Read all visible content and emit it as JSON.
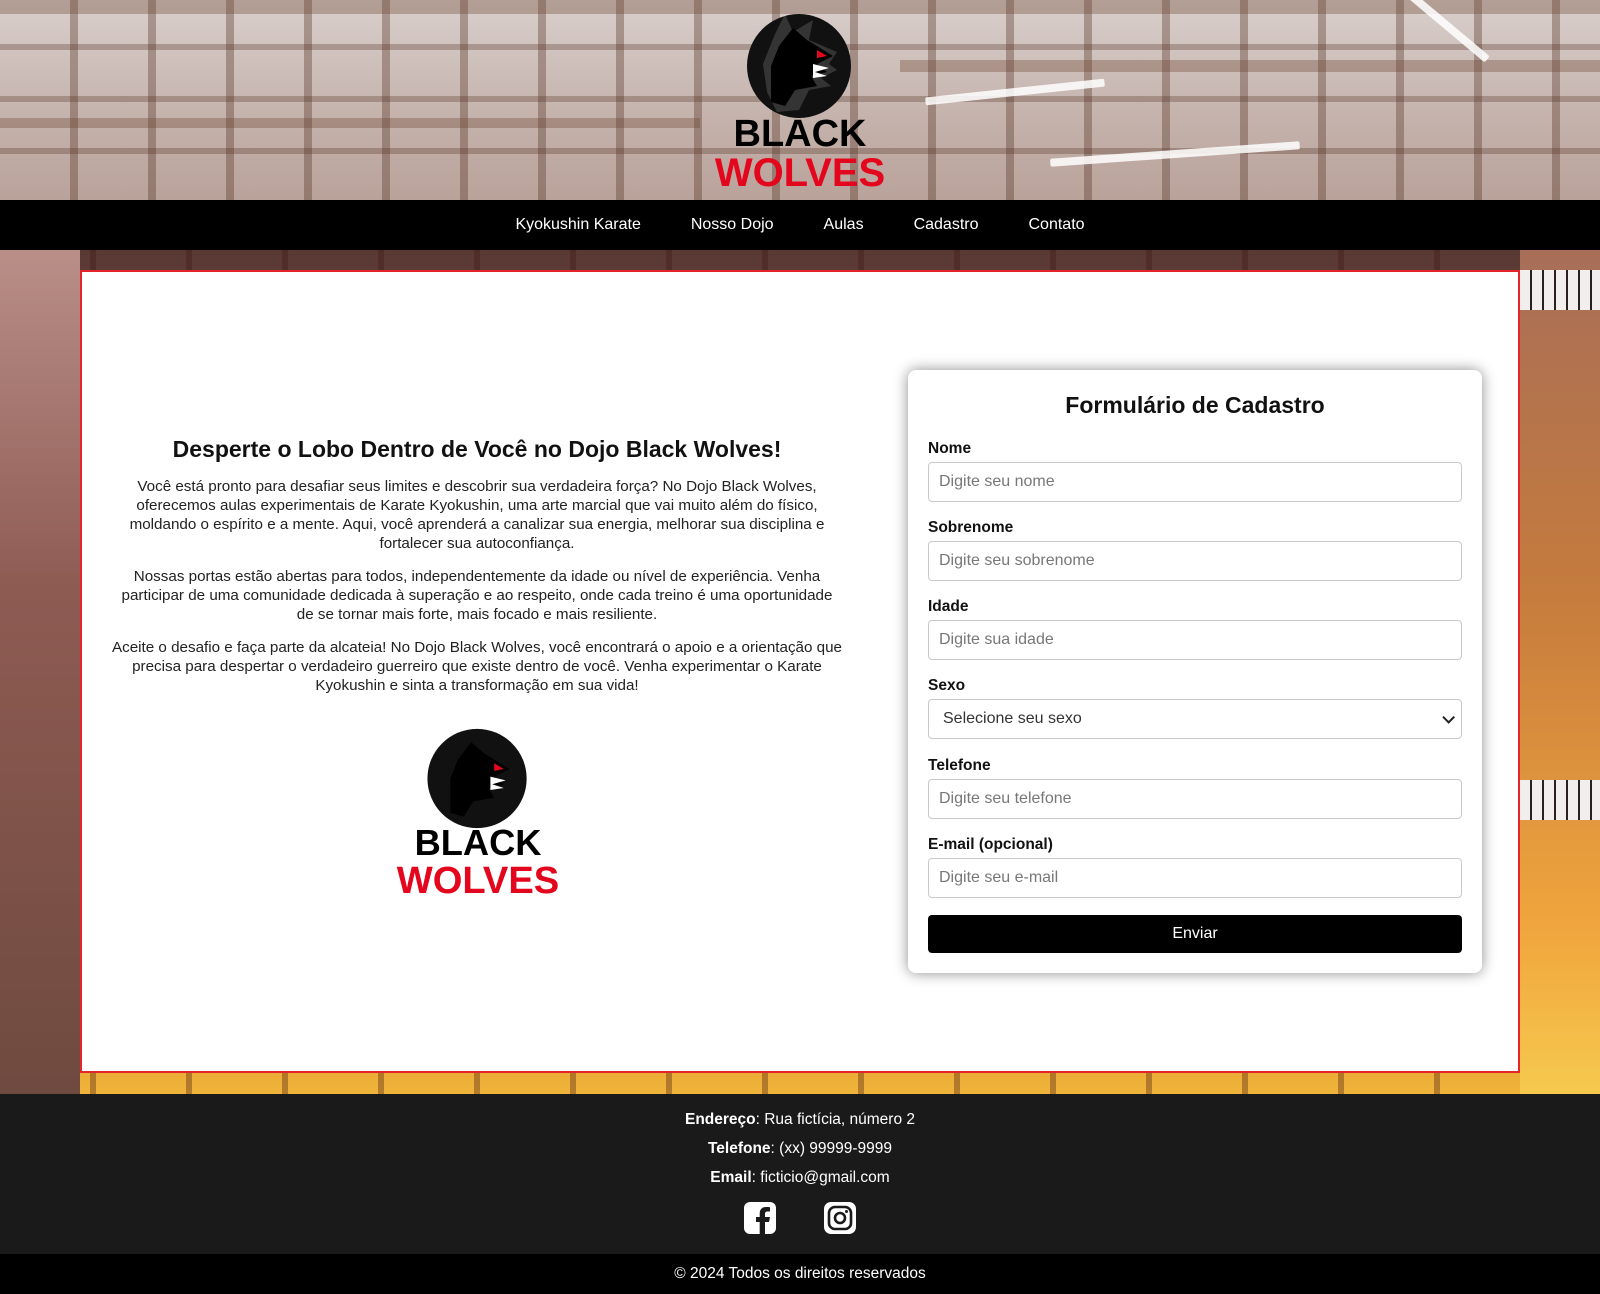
{
  "brand": {
    "logo_line1": "BLACK",
    "logo_line2": "WOLVES",
    "colors": {
      "red": "#e3061c",
      "black": "#000000",
      "accent_border": "#e3242b"
    }
  },
  "nav": {
    "items": [
      {
        "label": "Kyokushin Karate"
      },
      {
        "label": "Nosso Dojo"
      },
      {
        "label": "Aulas"
      },
      {
        "label": "Cadastro"
      },
      {
        "label": "Contato"
      }
    ]
  },
  "intro": {
    "title": "Desperte o Lobo Dentro de Você no Dojo Black Wolves!",
    "paragraphs": [
      "Você está pronto para desafiar seus limites e descobrir sua verdadeira força? No Dojo Black Wolves, oferecemos aulas experimentais de Karate Kyokushin, uma arte marcial que vai muito além do físico, moldando o espírito e a mente. Aqui, você aprenderá a canalizar sua energia, melhorar sua disciplina e fortalecer sua autoconfiança.",
      "Nossas portas estão abertas para todos, independentemente da idade ou nível de experiência. Venha participar de uma comunidade dedicada à superação e ao respeito, onde cada treino é uma oportunidade de se tornar mais forte, mais focado e mais resiliente.",
      "Aceite o desafio e faça parte da alcateia! No Dojo Black Wolves, você encontrará o apoio e a orientação que precisa para despertar o verdadeiro guerreiro que existe dentro de você. Venha experimentar o Karate Kyokushin e sinta a transformação em sua vida!"
    ]
  },
  "form": {
    "title": "Formulário de Cadastro",
    "fields": [
      {
        "label": "Nome",
        "placeholder": "Digite seu nome",
        "value": ""
      },
      {
        "label": "Sobrenome",
        "placeholder": "Digite seu sobrenome",
        "value": ""
      },
      {
        "label": "Idade",
        "placeholder": "Digite sua idade",
        "value": ""
      },
      {
        "label": "Sexo",
        "selected": "Selecione seu sexo"
      },
      {
        "label": "Telefone",
        "placeholder": "Digite seu telefone",
        "value": ""
      },
      {
        "label": "E-mail (opcional)",
        "placeholder": "Digite seu e-mail",
        "value": ""
      }
    ],
    "submit_label": "Enviar"
  },
  "footer": {
    "address_label": "Endereço",
    "address_value": ": Rua fictícia, número 2",
    "phone_label": "Telefone",
    "phone_value": ": (xx) 99999-9999",
    "email_label": "Email",
    "email_value": ": ficticio@gmail.com",
    "social_icons": [
      "facebook-icon",
      "instagram-icon"
    ],
    "copyright": "© 2024 Todos os direitos reservados"
  }
}
